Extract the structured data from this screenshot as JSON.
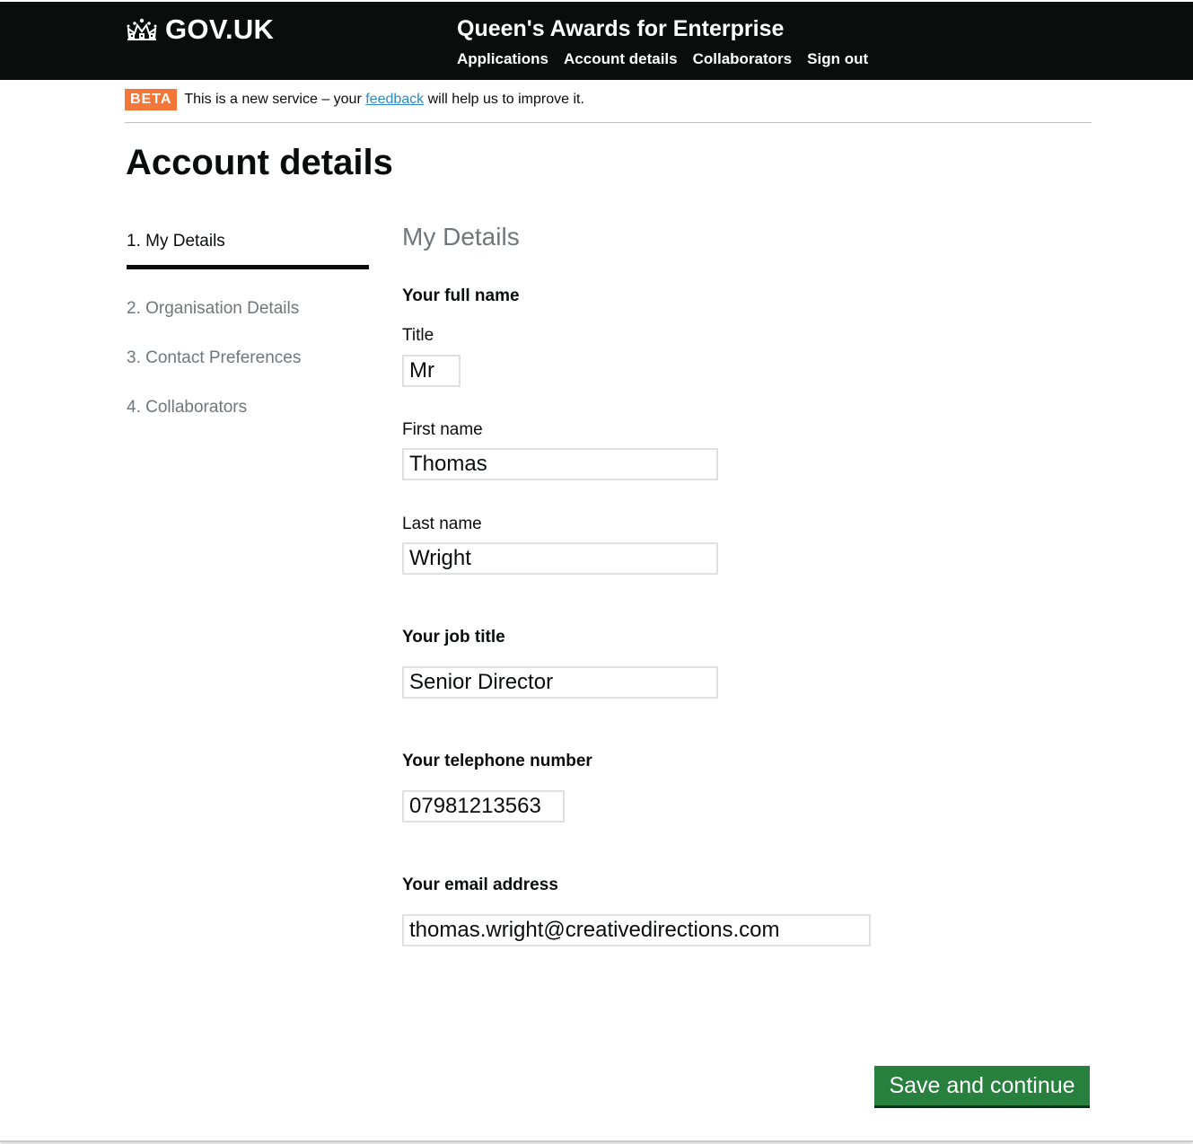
{
  "header": {
    "logo_text": "GOV.UK",
    "service_name": "Queen's Awards for Enterprise",
    "nav": [
      "Applications",
      "Account details",
      "Collaborators",
      "Sign out"
    ]
  },
  "beta": {
    "tag": "BETA",
    "text_before": "This is a new service – your",
    "link": "feedback",
    "text_after": "will help us to improve it."
  },
  "page_title": "Account details",
  "steps": [
    {
      "label": "1. My Details",
      "active": true
    },
    {
      "label": "2. Organisation Details",
      "active": false
    },
    {
      "label": "3. Contact Preferences",
      "active": false
    },
    {
      "label": "4. Collaborators",
      "active": false
    }
  ],
  "form": {
    "heading": "My Details",
    "full_name_label": "Your full name",
    "title_label": "Title",
    "title_value": "Mr",
    "first_name_label": "First name",
    "first_name_value": "Thomas",
    "last_name_label": "Last name",
    "last_name_value": "Wright",
    "job_title_label": "Your job title",
    "job_title_value": "Senior Director",
    "telephone_label": "Your telephone number",
    "telephone_value": "07981213563",
    "email_label": "Your email address",
    "email_value": "thomas.wright@creativedirections.com"
  },
  "save_button": "Save and continue",
  "colors": {
    "header_bg": "#0b0c0c",
    "beta_tag": "#f47738",
    "link": "#2b8cc4",
    "button": "#28803e"
  }
}
